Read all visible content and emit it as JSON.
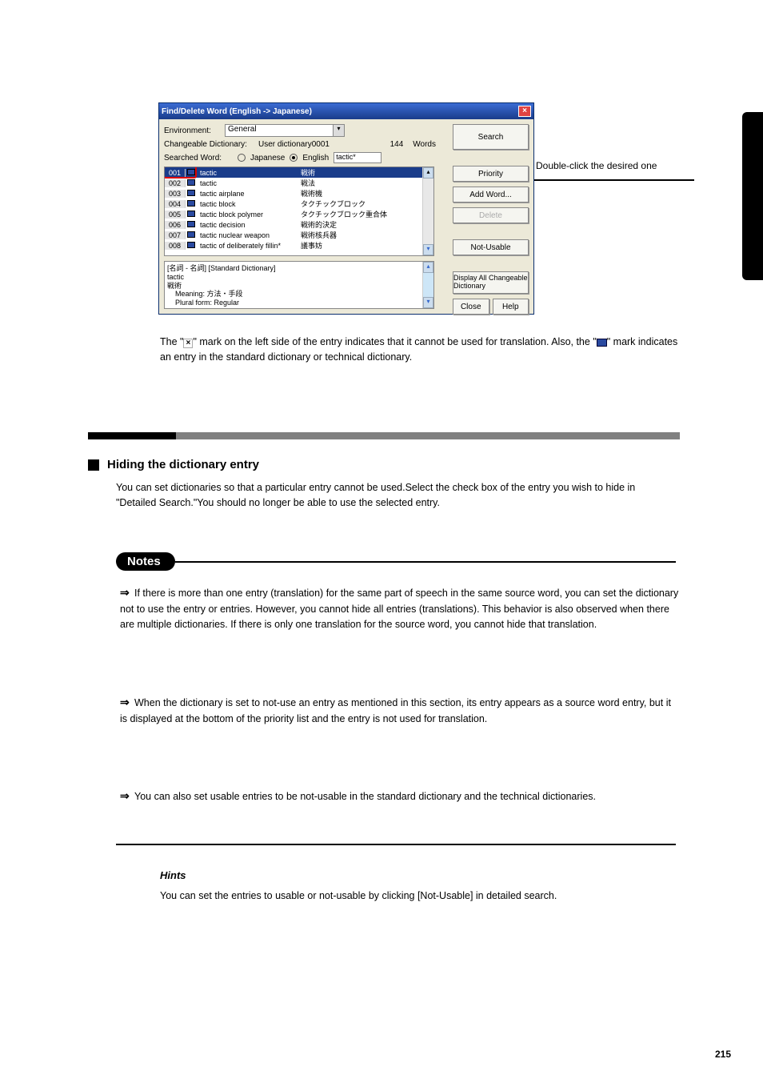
{
  "callout": "Double-click the desired one",
  "window": {
    "title": "Find/Delete Word (English -> Japanese)",
    "env_label": "Environment:",
    "env_value": "General",
    "chg_label": "Changeable Dictionary:",
    "chg_value": "User dictionary0001",
    "count": "144",
    "words_label": "Words",
    "searched_label": "Searched Word:",
    "radio_jp": "Japanese",
    "radio_en": "English",
    "word_value": "tactic*",
    "rows": [
      {
        "num": "001",
        "en": "tactic",
        "jp": "戦術",
        "sel": true
      },
      {
        "num": "002",
        "en": "tactic",
        "jp": "戦法"
      },
      {
        "num": "003",
        "en": "tactic airplane",
        "jp": "戦術機"
      },
      {
        "num": "004",
        "en": "tactic block",
        "jp": "タクチックブロック"
      },
      {
        "num": "005",
        "en": "tactic block polymer",
        "jp": "タクチックブロック重合体"
      },
      {
        "num": "006",
        "en": "tactic decision",
        "jp": "戦術的決定"
      },
      {
        "num": "007",
        "en": "tactic nuclear weapon",
        "jp": "戦術核兵器"
      },
      {
        "num": "008",
        "en": "tactic of deliberately fillin*",
        "jp": "議事妨"
      }
    ],
    "detail": {
      "line1": "[名詞 - 名詞]  [Standard Dictionary]",
      "line2": "tactic",
      "line3": "戦術",
      "line4": "Meaning: 方法・手段",
      "line5": "Plural form: Regular"
    },
    "buttons": {
      "search": "Search",
      "priority": "Priority",
      "add": "Add Word...",
      "delete": "Delete",
      "not_usable": "Not-Usable",
      "display_all": "Display All Changeable Dictionary",
      "close": "Close",
      "help": "Help"
    }
  },
  "para1": "The \"",
  "para1b": "\" mark on the left side of the entry indicates that it cannot be used for translation. Also, the \"",
  "para1c": "\" mark indicates an entry in the standard dictionary or technical dictionary.",
  "heading": "Hiding the dictionary entry",
  "para2": "You can set dictionaries so that a particular entry cannot be used.Select the check box of the entry you wish to hide in \"Detailed Search.\"You should no longer be able to use the selected entry.",
  "notes_badge": "Notes",
  "notes": [
    "If there is more than one entry (translation) for the same part of speech in the same source word, you can set the dictionary not to use the entry or entries. However, you cannot hide all entries (translations). This behavior is also observed when there are multiple dictionaries. If there is only one translation for the source word, you cannot hide that translation.",
    "When the dictionary is set to not-use an entry as mentioned in this section, its entry appears as a source word entry, but it is displayed at the bottom of the priority list and the entry is not used for translation.",
    "You can also set usable entries to be not-usable in the standard dictionary and the technical dictionaries."
  ],
  "hints_hdr": "Hints",
  "hints": "You can set the entries to usable or not-usable by clicking [Not-Usable] in detailed search.",
  "page_num": "215"
}
